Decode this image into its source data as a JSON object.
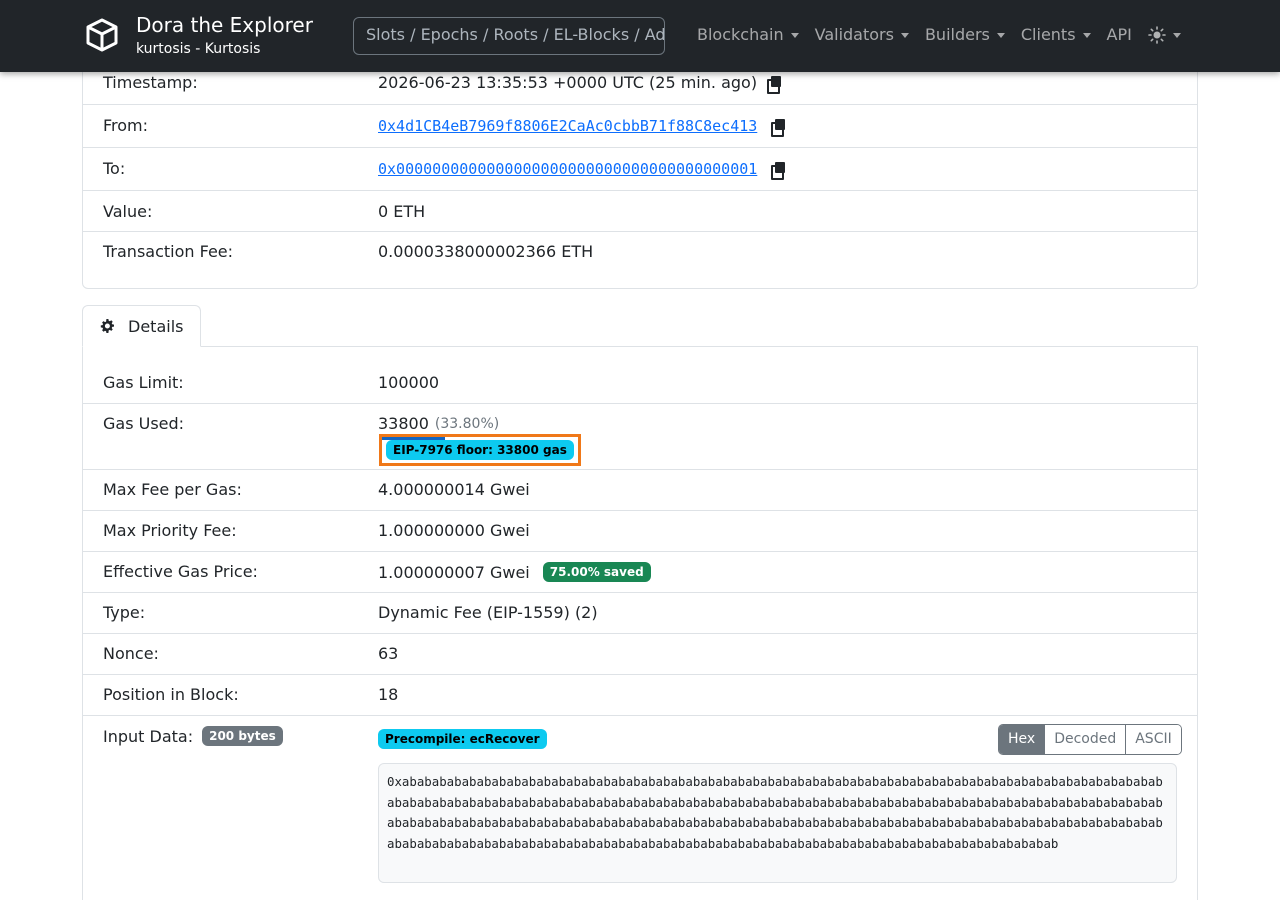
{
  "navbar": {
    "title": "Dora the Explorer",
    "subtitle": "kurtosis - Kurtosis",
    "search_placeholder": "Slots / Epochs / Roots / EL-Blocks / Addresses",
    "items": [
      "Blockchain",
      "Validators",
      "Builders",
      "Clients",
      "API"
    ],
    "theme_icon": "sun-icon"
  },
  "summary": {
    "timestamp_label": "Timestamp:",
    "timestamp_value": "2026-06-23 13:35:53 +0000 UTC (25 min. ago)",
    "from_label": "From:",
    "from_value": "0x4d1CB4eB7969f8806E2CaAc0cbbB71f88C8ec413",
    "to_label": "To:",
    "to_value": "0x0000000000000000000000000000000000000001",
    "value_label": "Value:",
    "value_value": "0 ETH",
    "fee_label": "Transaction Fee:",
    "fee_value": "0.0000338000002366 ETH"
  },
  "tabs": {
    "details": "Details"
  },
  "details": {
    "gas_limit_label": "Gas Limit:",
    "gas_limit_value": "100000",
    "gas_used_label": "Gas Used:",
    "gas_used_value": "33800",
    "gas_used_pct": "(33.80%)",
    "floor_badge": "EIP-7976 floor: 33800 gas",
    "max_fee_label": "Max Fee per Gas:",
    "max_fee_value": "4.000000014 Gwei",
    "max_priority_label": "Max Priority Fee:",
    "max_priority_value": "1.000000000 Gwei",
    "effective_label": "Effective Gas Price:",
    "effective_value": "1.000000007 Gwei",
    "saved_badge": "75.00% saved",
    "type_label": "Type:",
    "type_value": "Dynamic Fee (EIP-1559) (2)",
    "nonce_label": "Nonce:",
    "nonce_value": "63",
    "position_label": "Position in Block:",
    "position_value": "18",
    "input_label": "Input Data:",
    "input_size_badge": "200 bytes",
    "precompile_badge": "Precompile: ecRecover",
    "view_buttons": [
      "Hex",
      "Decoded",
      "ASCII"
    ],
    "active_view": "Hex",
    "input_hex": "0xabababababababababababababababababababababababababababababababababababababababababababababababababababababababababababababababababababababababababababababababababababababababababababababababababababababababababababababababababababababababababababababababababababababababababababababababababababababababababababababababababababababababababababababababababababababababababababababababababababababababab"
  },
  "colors": {
    "navbar_bg": "#212529",
    "link": "#0d6efd",
    "badge_info": "#0dcaf0",
    "badge_success": "#198754",
    "badge_secondary": "#6c757d",
    "highlight_border": "#f07818"
  }
}
